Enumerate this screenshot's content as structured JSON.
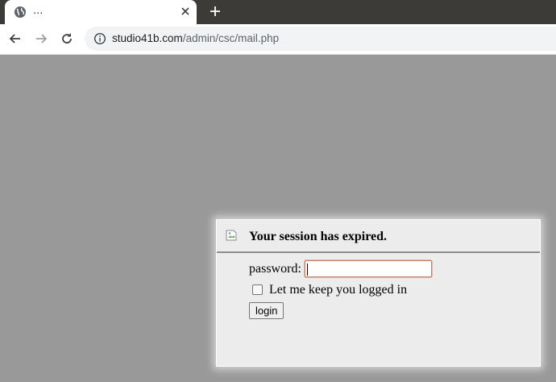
{
  "browser": {
    "tab": {
      "title": "...",
      "favicon": "globe-icon",
      "close_icon": "close-icon"
    },
    "new_tab_icon": "plus-icon",
    "toolbar": {
      "back_icon": "arrow-left-icon",
      "forward_icon": "arrow-right-icon",
      "reload_icon": "reload-icon",
      "site_info_icon": "info-icon",
      "url_host": "studio41b.com",
      "url_path": "/admin/csc/mail.php"
    }
  },
  "dialog": {
    "header_image": "broken-image-icon",
    "title": "Your session has expired.",
    "password_label": "password:",
    "password_value": "",
    "keep_logged_in_label": "Let me keep you logged in",
    "keep_logged_in_checked": false,
    "login_button": "login"
  },
  "colors": {
    "page_background": "#999999",
    "dialog_background": "#ececec",
    "tabstrip_background": "#3c3b37",
    "input_focus_border": "#c0806a"
  }
}
